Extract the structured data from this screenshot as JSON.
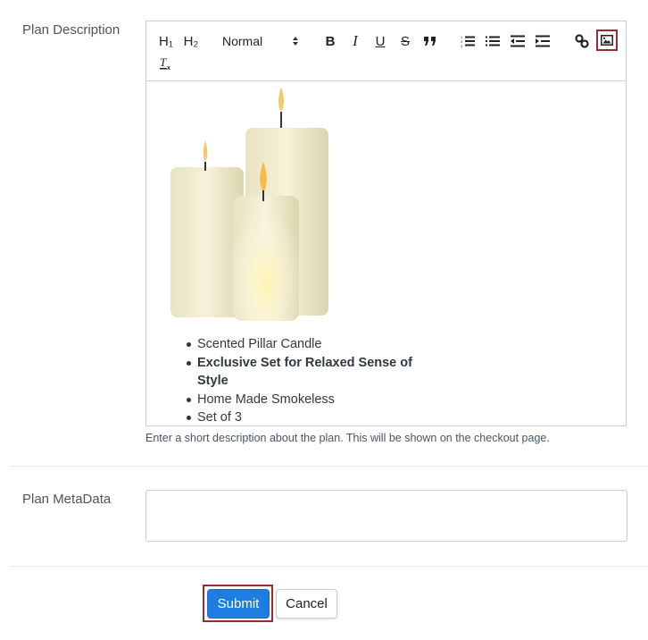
{
  "form": {
    "plan_description": {
      "label": "Plan Description",
      "help_text": "Enter a short description about the plan. This will be shown on the checkout page.",
      "toolbar": {
        "h1": "H₁",
        "h2": "H₂",
        "header_select_value": "Normal",
        "bold": "B",
        "italic": "I",
        "underline": "U",
        "strike": "S",
        "icons": [
          "header-1-icon",
          "header-2-icon",
          "bold-icon",
          "italic-icon",
          "underline-icon",
          "strike-icon",
          "blockquote-icon",
          "ordered-list-icon",
          "bullet-list-icon",
          "outdent-icon",
          "indent-icon",
          "link-icon",
          "image-icon",
          "clean-format-icon"
        ]
      },
      "content": {
        "image_alt": "Three ivory pillar candles, lit",
        "bullets": [
          {
            "text": "Scented Pillar Candle",
            "bold": false
          },
          {
            "text": "Exclusive Set for Relaxed Sense of Style",
            "bold": true
          },
          {
            "text": "Home Made Smokeless",
            "bold": false
          },
          {
            "text": "Set of 3",
            "bold": false
          }
        ]
      }
    },
    "plan_metadata": {
      "label": "Plan MetaData",
      "value": ""
    },
    "buttons": {
      "submit": "Submit",
      "cancel": "Cancel"
    }
  },
  "colors": {
    "accent": "#1e7de0",
    "highlight_border": "#9a2b33"
  }
}
